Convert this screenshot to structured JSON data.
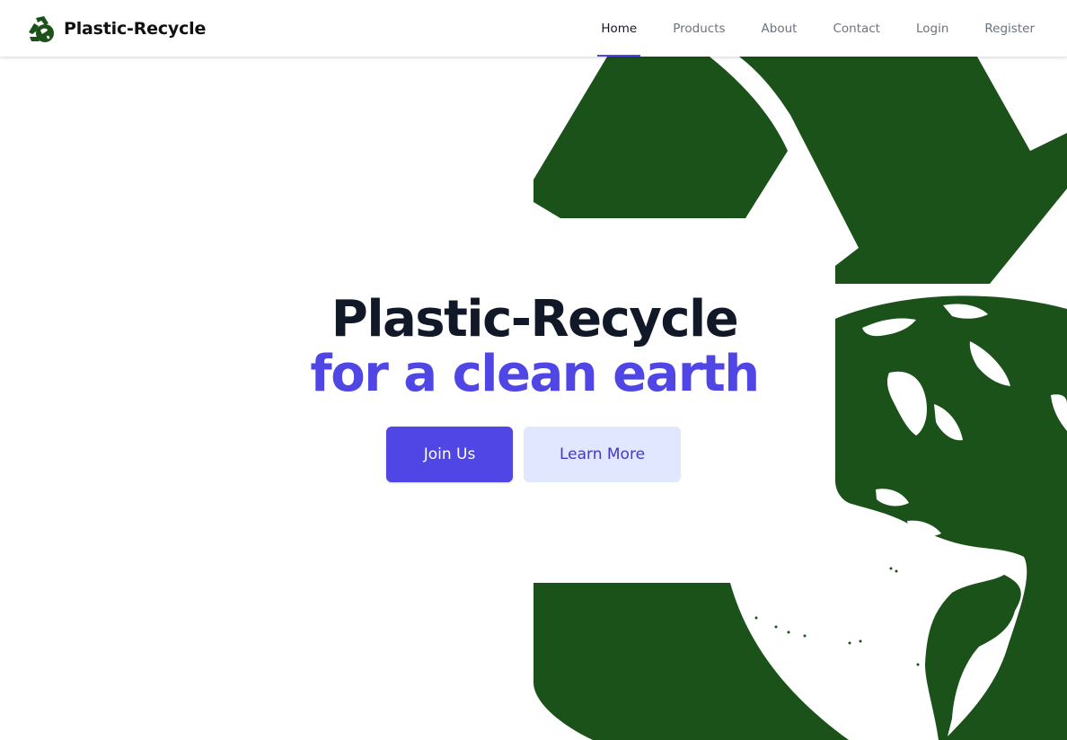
{
  "brand": {
    "name": "Plastic-Recycle",
    "logo_icon": "recycle-globe-icon"
  },
  "nav": {
    "items": [
      {
        "label": "Home",
        "active": true
      },
      {
        "label": "Products",
        "active": false
      },
      {
        "label": "About",
        "active": false
      },
      {
        "label": "Contact",
        "active": false
      },
      {
        "label": "Login",
        "active": false
      },
      {
        "label": "Register",
        "active": false
      }
    ]
  },
  "hero": {
    "title": "Plastic-Recycle",
    "subtitle": "for a clean earth",
    "primary_button": "Join Us",
    "secondary_button": "Learn More",
    "background_graphic": "recycle-globe-graphic"
  },
  "colors": {
    "accent": "#4f46e5",
    "accent_light": "#e0e7ff",
    "heading": "#111827",
    "nav_muted": "#6b7280",
    "graphic_green": "#1a5219"
  }
}
